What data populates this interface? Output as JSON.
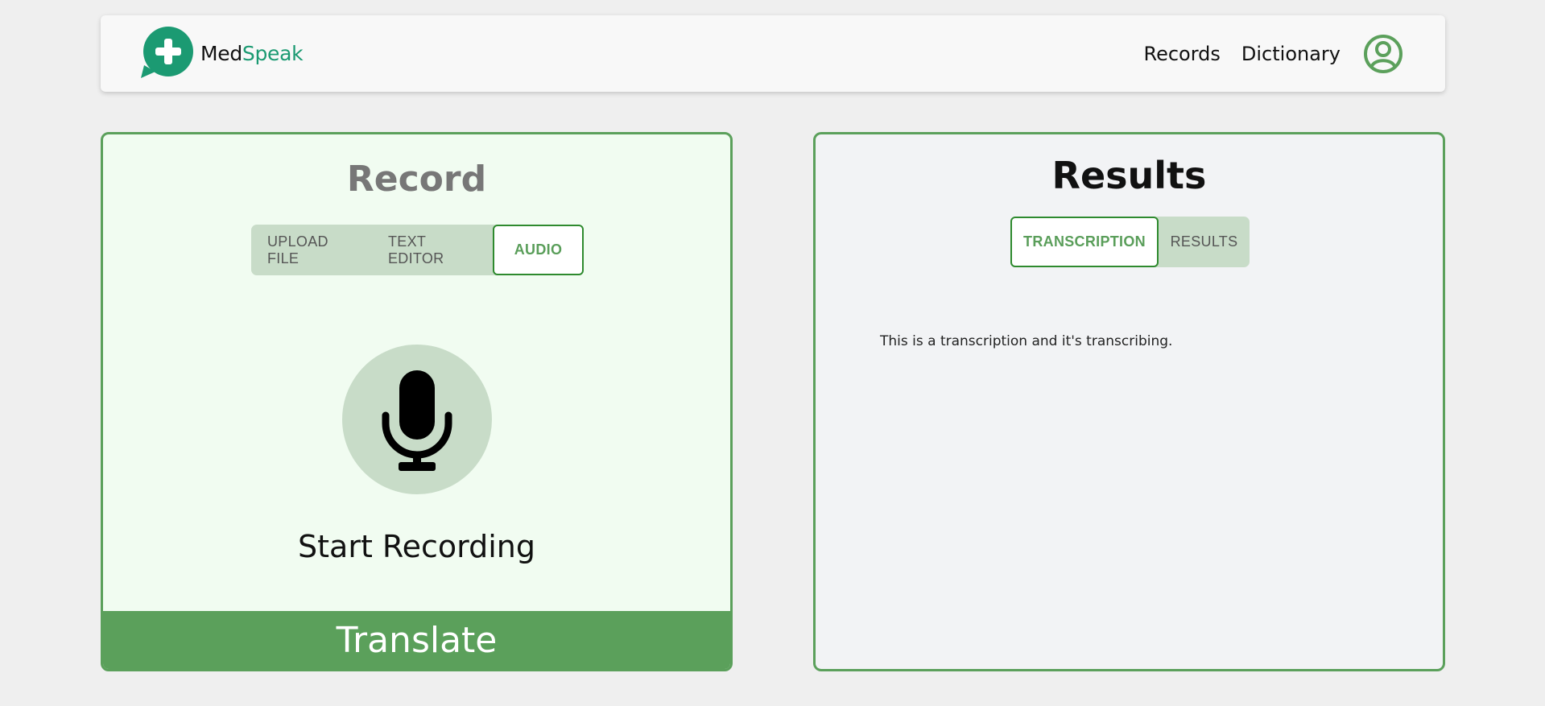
{
  "nav": {
    "brand_part1": "Med",
    "brand_part2": "Speak",
    "links": [
      "Records",
      "Dictionary"
    ],
    "logo_icon": "chat-plus-icon",
    "user_icon": "user-circle-icon"
  },
  "record": {
    "title": "Record",
    "tabs": [
      "UPLOAD FILE",
      "TEXT EDITOR",
      "AUDIO"
    ],
    "active_tab": "AUDIO",
    "mic_icon": "microphone-icon",
    "start_label": "Start Recording",
    "translate_label": "Translate"
  },
  "results": {
    "title": "Results",
    "tabs": [
      "TRANSCRIPTION",
      "RESULTS"
    ],
    "active_tab": "TRANSCRIPTION",
    "transcript_text": "This is a transcription and it's transcribing."
  },
  "colors": {
    "accent_green": "#5ba05b",
    "brand_teal": "#1b9a72",
    "tab_bg": "#c8dcc8",
    "record_panel_bg": "#f1fcf1",
    "results_panel_bg": "#f2f3f5"
  }
}
